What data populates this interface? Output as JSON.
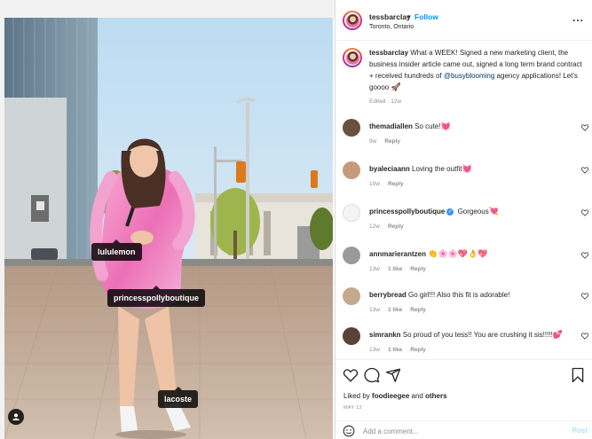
{
  "header": {
    "username": "tessbarclay",
    "dot": "•",
    "follow_label": "Follow",
    "location": "Toronto, Ontario",
    "more_label": "..."
  },
  "caption": {
    "username": "tessbarclay",
    "text_before": " What a WEEK! Signed a new marketing client, the business insider article came out, signed a long term brand contract + received hundreds of ",
    "mention": "@busyblooming",
    "text_after": " agency applications! Let's goooo ",
    "emoji": "🚀",
    "meta": "Edited · 12w"
  },
  "photo_tags": [
    {
      "label": "lululemon"
    },
    {
      "label": "princesspollyboutique"
    },
    {
      "label": "lacoste"
    }
  ],
  "comments": [
    {
      "username": "themadiallen",
      "text": " So cute!",
      "emoji": "💓",
      "time": "9w",
      "likes": "",
      "reply": "Reply",
      "verified": false,
      "avatar_color": "#6b4f3f"
    },
    {
      "username": "byaleciaann",
      "text": " Loving the outfit",
      "emoji": "💓",
      "time": "10w",
      "likes": "",
      "reply": "Reply",
      "verified": false,
      "avatar_color": "#c79a7a"
    },
    {
      "username": "princesspollyboutique",
      "text": " Gorgeous",
      "emoji": "💘",
      "time": "12w",
      "likes": "",
      "reply": "Reply",
      "verified": true,
      "avatar_color": "#f4f4f4"
    },
    {
      "username": "annmarierantzen",
      "text": " ",
      "emoji": "👏🌸🌸💖👌💖",
      "time": "13w",
      "likes": "1 like",
      "reply": "Reply",
      "verified": false,
      "avatar_color": "#9a9a9a"
    },
    {
      "username": "berrybread",
      "text": " Go girl!!! Also this fit is adorable!",
      "emoji": "",
      "time": "13w",
      "likes": "1 like",
      "reply": "Reply",
      "verified": false,
      "avatar_color": "#c4a98e"
    },
    {
      "username": "simrankn",
      "text": " So proud of you tess!! You are crushing it sis!!!!!",
      "emoji": "💕",
      "time": "13w",
      "likes": "1 like",
      "reply": "Reply",
      "verified": false,
      "avatar_color": "#5a4236"
    }
  ],
  "footer": {
    "liked_by_prefix": "Liked by ",
    "liked_by_user": "foodieegee",
    "and_text": " and ",
    "others": "others",
    "date": "MAY 12",
    "comment_placeholder": "Add a comment...",
    "post_label": "Post"
  },
  "colors": {
    "accent": "#0095f6",
    "mention": "#00376b",
    "muted": "#8e8e8e",
    "text": "#262626",
    "post_disabled": "#b2dffc"
  },
  "icons": [
    "heart-icon",
    "comment-icon",
    "share-icon",
    "bookmark-icon",
    "smiley-icon",
    "more-icon",
    "user-tag-icon",
    "verified-icon"
  ]
}
